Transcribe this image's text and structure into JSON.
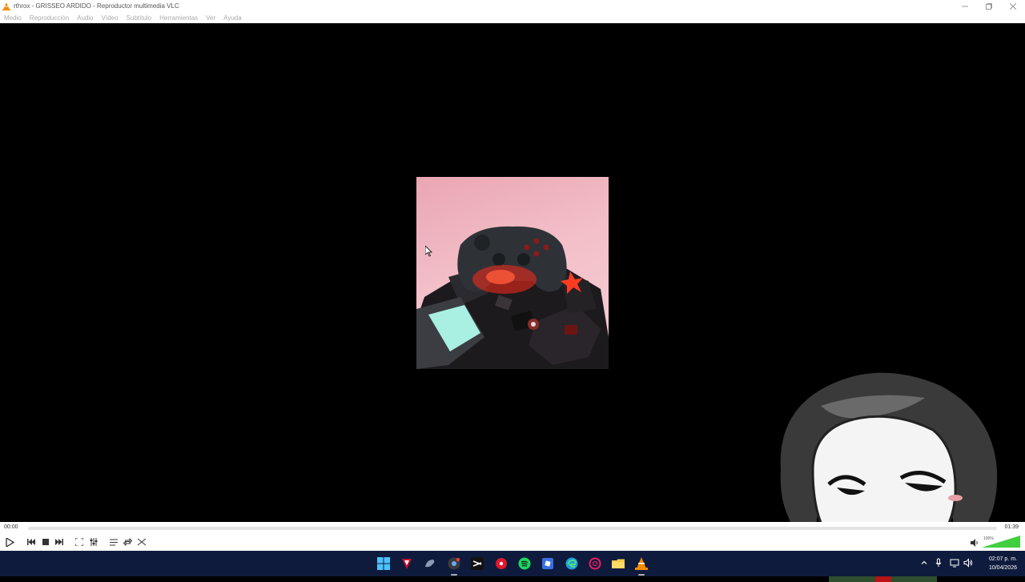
{
  "window": {
    "title": "rthrox - GRISSEO ARDIDO - Reproductor multimedia VLC",
    "controls": [
      "minimize",
      "restore",
      "close"
    ]
  },
  "menu": {
    "items": [
      "Medio",
      "Reproducción",
      "Audio",
      "Vídeo",
      "Subtítulo",
      "Herramientas",
      "Ver",
      "Ayuda"
    ]
  },
  "player": {
    "elapsed": "00:00",
    "total": "01:39",
    "progress": 0.0,
    "volume_label": "100%",
    "volume": 1.0
  },
  "taskbar": {
    "clock_time": "02:07 p. m.",
    "clock_date": "10/04/2026",
    "apps": [
      "start-icon",
      "app-red-icon",
      "app-bird-icon",
      "chrome-icon",
      "capcut-icon",
      "app-red-circle-icon",
      "spotify-icon",
      "roblox-icon",
      "edge-icon",
      "app-ring-icon",
      "file-explorer-icon",
      "vlc-icon"
    ]
  },
  "colors": {
    "vlc_orange": "#f48b00",
    "taskbar_bg": "#0f1b3d",
    "volume_green": "#3fcf3f"
  }
}
